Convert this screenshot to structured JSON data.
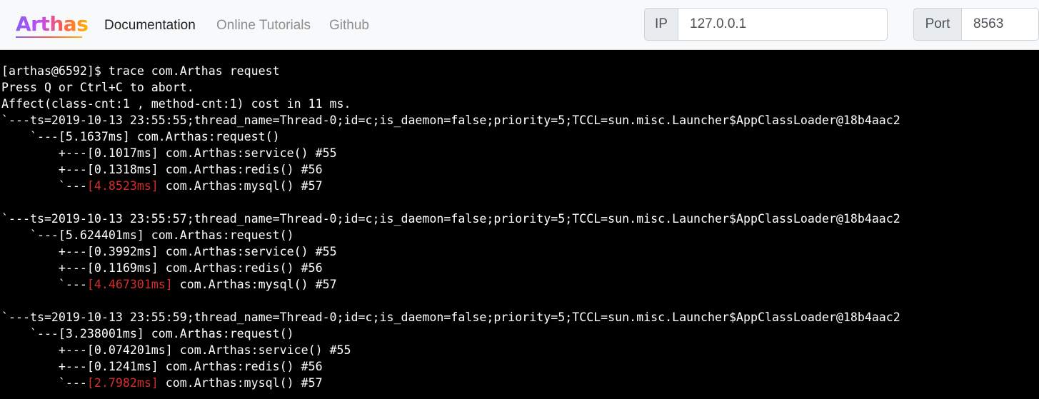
{
  "nav": {
    "logo": "Arthas",
    "links": [
      "Documentation",
      "Online Tutorials",
      "Github"
    ]
  },
  "connection": {
    "ip_label": "IP",
    "ip_value": "127.0.0.1",
    "port_label": "Port",
    "port_value": "8563"
  },
  "terminal": {
    "prompt_line": "[arthas@6592]$ trace com.Arthas request",
    "abort_line": "Press Q or Ctrl+C to abort.",
    "affect_line": "Affect(class-cnt:1 , method-cnt:1) cost in 11 ms.",
    "traces": [
      {
        "header": "`---ts=2019-10-13 23:55:55;thread_name=Thread-0;id=c;is_daemon=false;priority=5;TCCL=sun.misc.Launcher$AppClassLoader@18b4aac2",
        "root": "    `---[5.1637ms] com.Arthas:request()",
        "calls": [
          {
            "prefix": "        +---",
            "time": "[0.1017ms]",
            "rest": " com.Arthas:service() #55",
            "slow": false
          },
          {
            "prefix": "        +---",
            "time": "[0.1318ms]",
            "rest": " com.Arthas:redis() #56",
            "slow": false
          },
          {
            "prefix": "        `---",
            "time": "[4.8523ms]",
            "rest": " com.Arthas:mysql() #57",
            "slow": true
          }
        ]
      },
      {
        "header": "`---ts=2019-10-13 23:55:57;thread_name=Thread-0;id=c;is_daemon=false;priority=5;TCCL=sun.misc.Launcher$AppClassLoader@18b4aac2",
        "root": "    `---[5.624401ms] com.Arthas:request()",
        "calls": [
          {
            "prefix": "        +---",
            "time": "[0.3992ms]",
            "rest": " com.Arthas:service() #55",
            "slow": false
          },
          {
            "prefix": "        +---",
            "time": "[0.1169ms]",
            "rest": " com.Arthas:redis() #56",
            "slow": false
          },
          {
            "prefix": "        `---",
            "time": "[4.467301ms]",
            "rest": " com.Arthas:mysql() #57",
            "slow": true
          }
        ]
      },
      {
        "header": "`---ts=2019-10-13 23:55:59;thread_name=Thread-0;id=c;is_daemon=false;priority=5;TCCL=sun.misc.Launcher$AppClassLoader@18b4aac2",
        "root": "    `---[3.238001ms] com.Arthas:request()",
        "calls": [
          {
            "prefix": "        +---",
            "time": "[0.074201ms]",
            "rest": " com.Arthas:service() #55",
            "slow": false
          },
          {
            "prefix": "        +---",
            "time": "[0.1241ms]",
            "rest": " com.Arthas:redis() #56",
            "slow": false
          },
          {
            "prefix": "        `---",
            "time": "[2.7982ms]",
            "rest": " com.Arthas:mysql() #57",
            "slow": true
          }
        ]
      }
    ]
  },
  "colors": {
    "terminal_bg": "#000000",
    "terminal_fg": "#ffffff",
    "slow_time": "#d72d2d",
    "navbar_bg": "#f8f9fa"
  }
}
